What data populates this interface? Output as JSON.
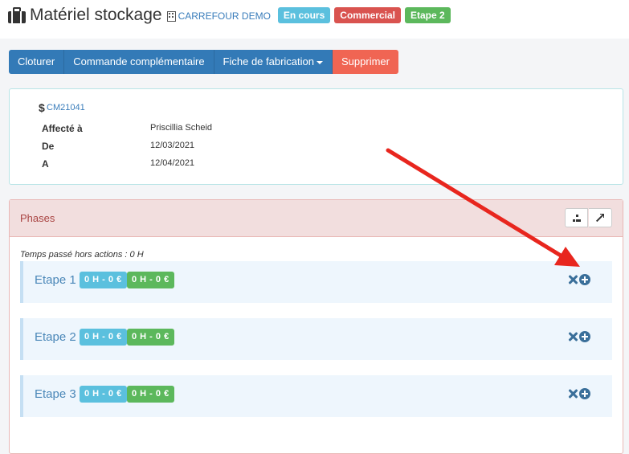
{
  "header": {
    "title": "Matériel stockage",
    "client": "CARREFOUR DEMO",
    "badges": {
      "status": "En cours",
      "type": "Commercial",
      "step": "Etape 2"
    }
  },
  "toolbar": {
    "close": "Cloturer",
    "extra_order": "Commande complémentaire",
    "fabrication": "Fiche de fabrication",
    "delete": "Supprimer"
  },
  "info": {
    "reference": "CM21041",
    "assigned_label": "Affecté à",
    "assigned_value": "Priscillia Scheid",
    "from_label": "De",
    "from_value": "12/03/2021",
    "to_label": "A",
    "to_value": "12/04/2021"
  },
  "phases": {
    "title": "Phases",
    "hors_actions": "Temps passé hors actions : 0 H",
    "items": [
      {
        "name": "Etape 1",
        "time": "0 H - 0 €",
        "time2": "0 H - 0 €"
      },
      {
        "name": "Etape 2",
        "time": "0 H - 0 €",
        "time2": "0 H - 0 €"
      },
      {
        "name": "Etape 3",
        "time": "0 H - 0 €",
        "time2": "0 H - 0 €"
      }
    ]
  },
  "colors": {
    "primary": "#337ab7",
    "danger": "#f06553",
    "info": "#5bc0de",
    "success": "#5cb85c",
    "badge_red": "#d9534f",
    "annotation_arrow": "#e8261e"
  }
}
